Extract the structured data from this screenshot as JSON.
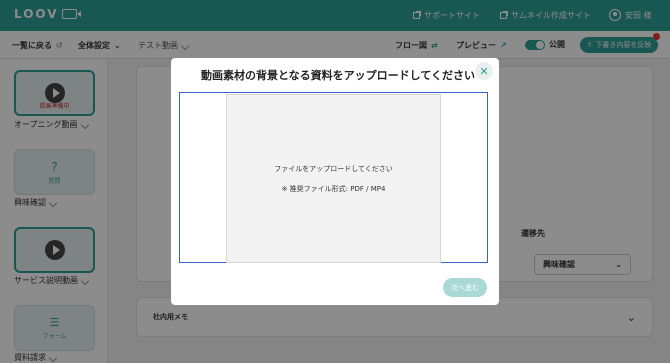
{
  "header": {
    "logo": "LOOV",
    "support_link": "サポートサイト",
    "thumbnail_link": "サムネイル作成サイト",
    "user_name": "安田 様"
  },
  "toolbar": {
    "back": "一覧に戻る",
    "settings": "全体設定",
    "title": "テスト動画",
    "flow": "フロー図",
    "preview": "プレビュー",
    "publish": "公開",
    "reflect": "下書き内容を反映"
  },
  "sidebar": {
    "scenes": [
      {
        "label": "オープニング動画",
        "status": "録画準備中"
      },
      {
        "label": "興味確認",
        "sub": "質問"
      },
      {
        "label": "サービス説明動画"
      },
      {
        "label": "資料請求",
        "sub": "フォーム"
      }
    ]
  },
  "main": {
    "transition_label": "遷移先",
    "transition_value": "興味確認",
    "memo_label": "社内用メモ"
  },
  "modal": {
    "title": "動画素材の背景となる資料をアップロードしてください",
    "drop_text": "ファイルをアップロードしてください",
    "formats": "※ 推奨ファイル形式: PDF / MP4",
    "next": "次へ進む"
  }
}
